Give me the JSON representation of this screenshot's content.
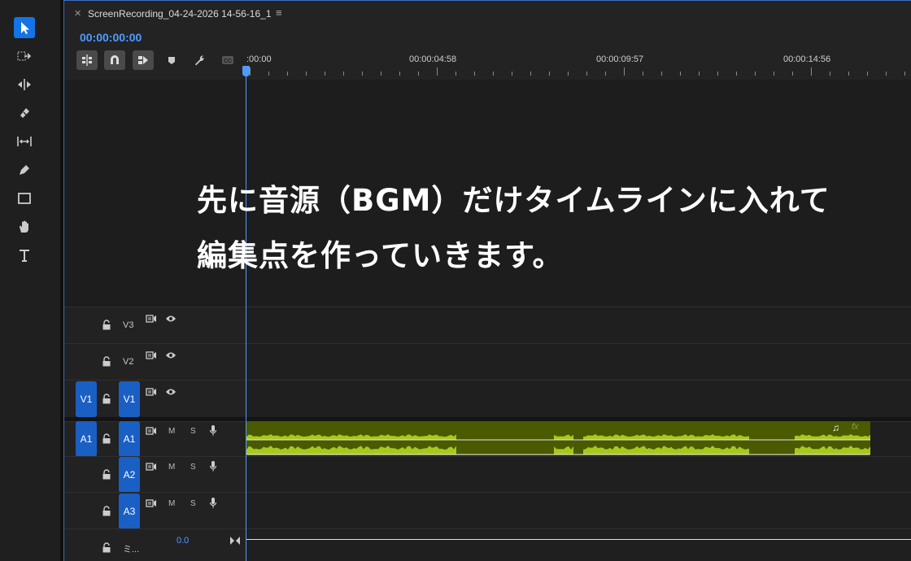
{
  "panel": {
    "sequence_title": "ScreenRecording_04-24-2026 14-56-16_1",
    "timecode": "00:00:00:00"
  },
  "ruler": {
    "labels": [
      ":00:00",
      "00:00:04:58",
      "00:00:09:57",
      "00:00:14:56"
    ]
  },
  "caption": {
    "line1": "先に音源（BGM）だけタイムラインに入れて",
    "line2": "編集点を作っていきます。"
  },
  "tracks": {
    "v3": {
      "name": "V3"
    },
    "v2": {
      "name": "V2"
    },
    "v1": {
      "name": "V1",
      "source_chip": "V1",
      "target_chip": "V1"
    },
    "a1": {
      "name": "A1",
      "source_chip": "A1",
      "target_chip": "A1",
      "mute": "M",
      "solo": "S"
    },
    "a2": {
      "name": "A2",
      "mute": "M",
      "solo": "S"
    },
    "a3": {
      "name": "A3",
      "mute": "M",
      "solo": "S"
    },
    "master": {
      "name": "ミ...",
      "value": "0.0"
    }
  },
  "clip": {
    "fx_label": "fx",
    "note": "♫"
  },
  "colors": {
    "accent": "#1473e6",
    "clip_fill": "#4a5a00",
    "waveform": "#a8c81e",
    "playhead": "#4f9cff"
  }
}
